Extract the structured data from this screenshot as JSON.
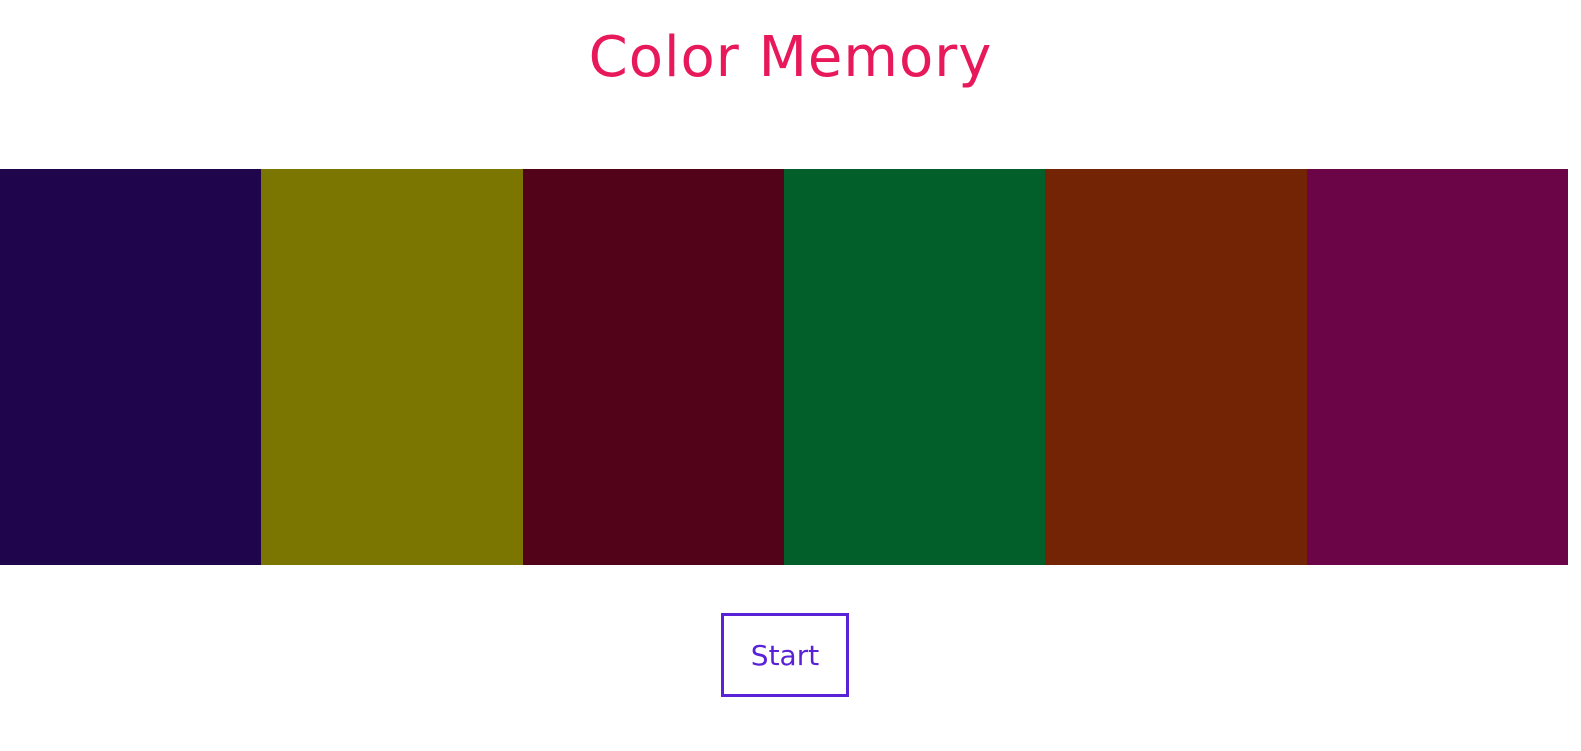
{
  "app": {
    "title": "Color Memory"
  },
  "colors": {
    "title": "#e8195a",
    "button": "#5a22d6"
  },
  "swatches": [
    {
      "color": "#1f054c"
    },
    {
      "color": "#7a7601"
    },
    {
      "color": "#52031a"
    },
    {
      "color": "#025f2a"
    },
    {
      "color": "#722405"
    },
    {
      "color": "#6c0448"
    }
  ],
  "controls": {
    "start_label": "Start"
  }
}
